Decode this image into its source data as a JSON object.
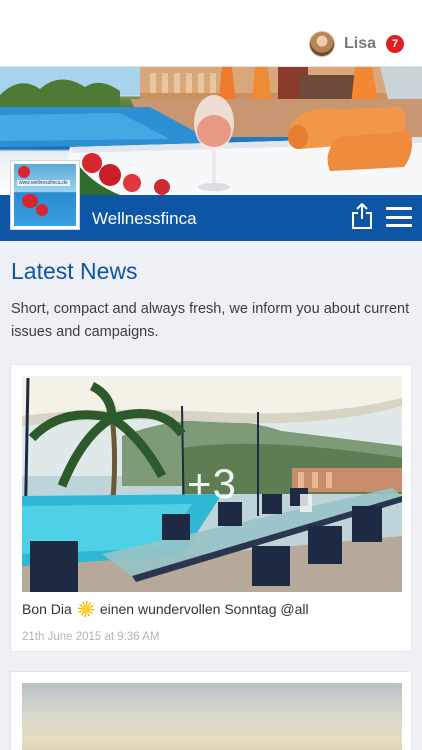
{
  "header": {
    "user": {
      "name": "Lisa",
      "notifications": "7"
    }
  },
  "brand": {
    "name": "Wellnessfinca",
    "logo_text": "www.wellnessfinca.de"
  },
  "news": {
    "heading": "Latest News",
    "intro": "Short, compact and always fresh, we inform you about current issues and campaigns."
  },
  "posts": [
    {
      "more_photos": "+3",
      "text_before": "Bon Dia",
      "text_after": "einen wundervollen Sonntag @all",
      "date": "21th June 2015 at 9:36 AM"
    }
  ],
  "icons": {
    "share": "share-icon",
    "menu": "hamburger-menu-icon",
    "sun": "sun-emoji-icon"
  },
  "colors": {
    "brand_blue": "#0d56a6",
    "badge_red": "#e02020",
    "page_bg": "#eef0f6"
  }
}
